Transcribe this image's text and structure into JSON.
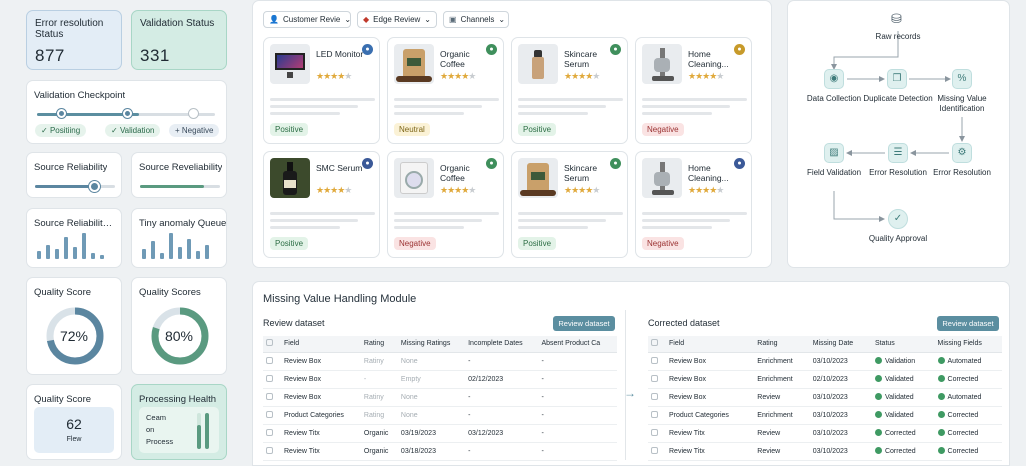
{
  "kpis": [
    {
      "title": "Error resolution Status",
      "value": "877"
    },
    {
      "title": "Validation Status",
      "value": "331"
    }
  ],
  "checkpoint": {
    "title": "Validation Checkpoint",
    "pills": [
      "Positiing",
      "Validation",
      "Negative"
    ]
  },
  "reliability": {
    "a": "Source Reliability",
    "b": "Source Reveliability"
  },
  "charts_row": {
    "a": "Source Reliability ...",
    "b": "Tiny anomaly Queue"
  },
  "quality": [
    {
      "title": "Quality Score",
      "value": "72%",
      "level": 0.72
    },
    {
      "title": "Quality Scores",
      "value": "80%",
      "level": 0.8
    }
  ],
  "quality_flew": {
    "title": "Quality Score",
    "value": "62",
    "label": "Flew"
  },
  "processing": {
    "title": "Processing Health",
    "lines": [
      "Ceam",
      "on",
      "Process"
    ]
  },
  "filters": [
    "Customer Revie",
    "Edge Review",
    "Channels"
  ],
  "products": [
    {
      "name": "LED Monitor",
      "sent": "Positive",
      "cls": "pos",
      "stars": 4,
      "badge": "#3a6fb0",
      "img": "monitor"
    },
    {
      "name": "Organic Coffee",
      "sent": "Neutral",
      "cls": "neu",
      "stars": 4,
      "badge": "#3f8f5c",
      "img": "coffee"
    },
    {
      "name": "Skincare Serum",
      "sent": "Positive",
      "cls": "pos",
      "stars": 4,
      "badge": "#3f8f5c",
      "img": "serum"
    },
    {
      "name": "Home Cleaning...",
      "sent": "Negative",
      "cls": "negb",
      "stars": 4,
      "badge": "#c79a2a",
      "img": "vacuum"
    },
    {
      "name": "SMC Serum",
      "sent": "Positive",
      "cls": "pos",
      "stars": 4,
      "badge": "#3b5998",
      "img": "bottle"
    },
    {
      "name": "Organic Coffee",
      "sent": "Negative",
      "cls": "negb",
      "stars": 4,
      "badge": "#3f8f5c",
      "img": "washer"
    },
    {
      "name": "Skincare Serum",
      "sent": "Positive",
      "cls": "pos",
      "stars": 4,
      "badge": "#3f8f5c",
      "img": "coffee"
    },
    {
      "name": "Home Cleaning...",
      "sent": "Negative",
      "cls": "negb",
      "stars": 4,
      "badge": "#3b5998",
      "img": "vacuum"
    }
  ],
  "flow": {
    "top": "Raw records",
    "nodes": [
      "Data Collection",
      "Duplicate Detection",
      "Missing Value Identification",
      "Field Validation",
      "Error Resolution",
      "Error Resolution",
      "Quality Approval"
    ]
  },
  "module": {
    "title": "Missing Value Handling Module",
    "review": {
      "title": "Review dataset",
      "button": "Review dataset",
      "headers": [
        "Field",
        "Rating",
        "Missing Ratings",
        "Incomplete Dates",
        "Absent Product Ca"
      ],
      "rows": [
        [
          "Review Box",
          "Ratiny",
          "None",
          "-",
          "-"
        ],
        [
          "Review Box",
          "-",
          "Empty",
          "02/12/2023",
          "-"
        ],
        [
          "Review Box",
          "Ratiny",
          "None",
          "-",
          "-"
        ],
        [
          "Product Categories",
          "Rating",
          "None",
          "-",
          "-"
        ],
        [
          "Review Titx",
          "Organic",
          "03/19/2023",
          "03/12/2023",
          "-"
        ],
        [
          "Review Titx",
          "Organic",
          "03/18/2023",
          "-",
          "-"
        ]
      ]
    },
    "corrected": {
      "title": "Corrected dataset",
      "button": "Review dataset",
      "headers": [
        "Field",
        "Rating",
        "Missing Date",
        "Status",
        "Missing Fields"
      ],
      "rows": [
        [
          "Review Box",
          "Enrichment",
          "03/10/2023",
          "Validation",
          "Automated"
        ],
        [
          "Review Box",
          "Enrichment",
          "02/10/2023",
          "Validated",
          "Corrected"
        ],
        [
          "Review Box",
          "Review",
          "03/10/2023",
          "Validated",
          "Automated"
        ],
        [
          "Product Categories",
          "Enrichment",
          "03/10/2023",
          "Validated",
          "Corrected"
        ],
        [
          "Review Titx",
          "Review",
          "03/10/2023",
          "Corrected",
          "Corrected"
        ],
        [
          "Review Titx",
          "Review",
          "03/10/2023",
          "Corrected",
          "Corrected"
        ]
      ]
    }
  },
  "colors": {
    "accent": "#5b8ea0",
    "teal": "#cfe9e4",
    "blue_tile": "#e3edf6",
    "positive": "#2d6e45",
    "negative": "#9b3232"
  }
}
